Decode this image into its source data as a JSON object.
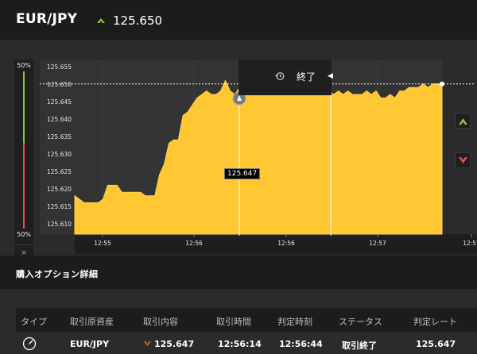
{
  "header": {
    "pair": "EUR/JPY",
    "price": "125.650",
    "trend": "up",
    "trend_icon": "up-arrow-icon"
  },
  "level_panel": {
    "top_label": "50%",
    "bottom_label": "50%",
    "close_glyph": "×",
    "colors": {
      "up": "#86c440",
      "down": "#e0573a"
    }
  },
  "expiry": {
    "icon": "history-clock-icon",
    "label": "終了"
  },
  "buttons": {
    "high_icon": "chevron-up-icon",
    "low_icon": "chevron-down-icon",
    "high_color": "#86c440",
    "low_color": "#e0573a"
  },
  "chart_data": {
    "type": "area",
    "color": "#ffc832",
    "y_ticks": [
      "125.655",
      "125.650",
      "125.645",
      "125.640",
      "125.635",
      "125.630",
      "125.625",
      "125.620",
      "125.615",
      "125.610"
    ],
    "x_ticks": [
      "12:55",
      "12:56",
      "12:56",
      "12:57",
      "12:57"
    ],
    "ylim": [
      125.607,
      125.657
    ],
    "current_rate_line": 125.65,
    "entry_rate": 125.647,
    "entry_label": "125.647",
    "values": [
      125.618,
      125.617,
      125.616,
      125.616,
      125.616,
      125.616,
      125.617,
      125.621,
      125.621,
      125.621,
      125.619,
      125.619,
      125.619,
      125.619,
      125.619,
      125.618,
      125.618,
      125.618,
      125.624,
      125.627,
      125.633,
      125.634,
      125.634,
      125.641,
      125.642,
      125.644,
      125.646,
      125.647,
      125.648,
      125.647,
      125.647,
      125.648,
      125.651,
      125.648,
      125.647,
      125.649,
      125.647,
      125.648,
      125.649,
      125.65,
      125.648,
      125.65,
      125.65,
      125.649,
      125.648,
      125.648,
      125.647,
      125.647,
      125.648,
      125.647,
      125.648,
      125.648,
      125.647,
      125.648,
      125.648,
      125.647,
      125.648,
      125.647,
      125.648,
      125.647,
      125.647,
      125.647,
      125.648,
      125.647,
      125.648,
      125.646,
      125.646,
      125.647,
      125.646,
      125.648,
      125.648,
      125.649,
      125.649,
      125.649,
      125.65,
      125.649,
      125.65,
      125.65,
      125.65
    ],
    "grid": true,
    "legend": "none"
  },
  "details": {
    "title": "購入オプション詳細",
    "columns": [
      "タイプ",
      "取引原資産",
      "取引内容",
      "取引時間",
      "判定時刻",
      "ステータス",
      "判定レート"
    ],
    "row": {
      "type_icon": "gauge-icon",
      "asset": "EUR/JPY",
      "direction": "low",
      "direction_icon": "low-arrow-icon",
      "content": "125.647",
      "trade_time": "12:56:14",
      "judge_time": "12:56:44",
      "status": "取引終了",
      "judge_rate": "125.647"
    }
  }
}
